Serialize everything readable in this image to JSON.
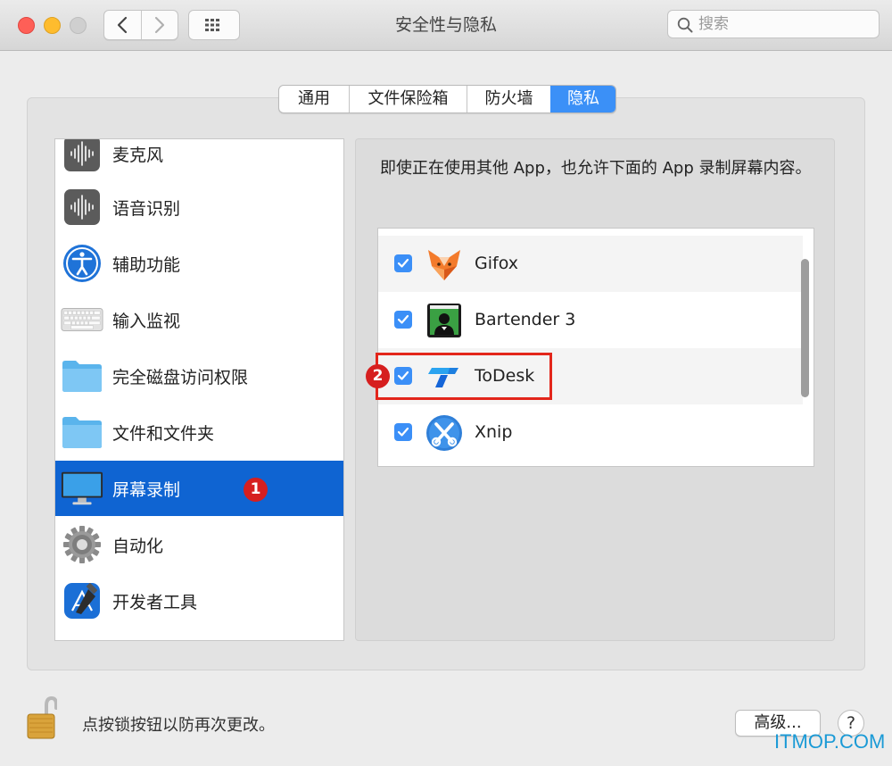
{
  "window": {
    "title": "安全性与隐私"
  },
  "toolbar": {
    "back_glyph": "‹",
    "forward_glyph": "›",
    "grid_icon": "grid-icon"
  },
  "search": {
    "placeholder": "搜索"
  },
  "tabs": [
    {
      "label": "通用",
      "active": false
    },
    {
      "label": "文件保险箱",
      "active": false
    },
    {
      "label": "防火墙",
      "active": false
    },
    {
      "label": "隐私",
      "active": true
    }
  ],
  "sidebar": {
    "items": [
      {
        "label": "麦克风",
        "icon": "microphone-icon"
      },
      {
        "label": "语音识别",
        "icon": "speech-recognition-icon"
      },
      {
        "label": "辅助功能",
        "icon": "accessibility-icon"
      },
      {
        "label": "输入监视",
        "icon": "keyboard-icon"
      },
      {
        "label": "完全磁盘访问权限",
        "icon": "folder-icon"
      },
      {
        "label": "文件和文件夹",
        "icon": "folder-icon"
      },
      {
        "label": "屏幕录制",
        "icon": "display-icon",
        "selected": true
      },
      {
        "label": "自动化",
        "icon": "gear-icon"
      },
      {
        "label": "开发者工具",
        "icon": "developer-tools-icon"
      }
    ]
  },
  "annotations": {
    "badge1": "1",
    "badge2": "2"
  },
  "main": {
    "description": "即使正在使用其他 App，也允许下面的 App 录制屏幕内容。",
    "apps": [
      {
        "label": "Gifox",
        "checked": true,
        "icon": "gifox-icon"
      },
      {
        "label": "Bartender 3",
        "checked": true,
        "icon": "bartender-icon"
      },
      {
        "label": "ToDesk",
        "checked": true,
        "icon": "todesk-icon"
      },
      {
        "label": "Xnip",
        "checked": true,
        "icon": "xnip-icon"
      }
    ]
  },
  "footer": {
    "lock_text": "点按锁按钮以防再次更改。",
    "advanced_label": "高级...",
    "help_label": "?"
  },
  "watermark": "ITMOP.COM",
  "colors": {
    "accent": "#3b90f7",
    "selection": "#0f64d2",
    "annotation_red": "#d61f1f"
  }
}
